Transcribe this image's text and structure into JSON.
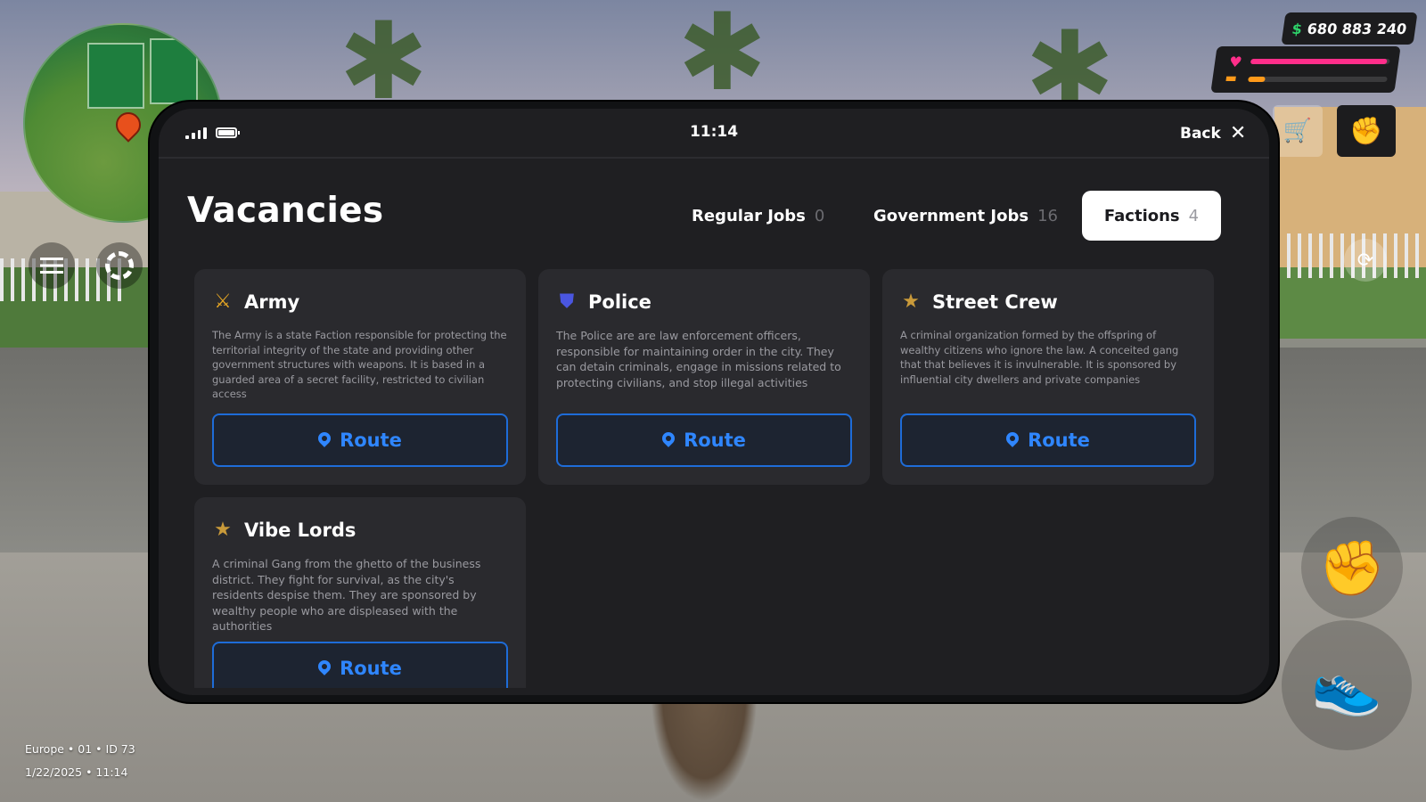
{
  "hud": {
    "money": "680 883 240",
    "money_symbol": "$",
    "health_level": 0.98,
    "food_level": 0.12,
    "server_line": "Europe • 01 • ID 73",
    "datetime_line": "1/22/2025 • 11:14",
    "icons": [
      "minimap",
      "menu-icon",
      "lifebuoy-icon",
      "heart-icon",
      "food-icon",
      "shop-cart-icon",
      "fist-icon",
      "camera-rotate-icon",
      "sprint-shoe-icon"
    ]
  },
  "phone": {
    "time": "11:14",
    "back_label": "Back",
    "title": "Vacancies",
    "tabs": [
      {
        "label": "Regular Jobs",
        "count": "0",
        "active": false
      },
      {
        "label": "Government Jobs",
        "count": "16",
        "active": false
      },
      {
        "label": "Factions",
        "count": "4",
        "active": true
      }
    ],
    "cards": [
      {
        "icon": "crossed-swords-icon",
        "icon_color": "#e6a623",
        "title": "Army",
        "description": "The Army is a state Faction responsible for protecting the territorial integrity of the state and providing other government structures with weapons. It is based in a guarded area of a secret facility, restricted to civilian access",
        "button": "Route"
      },
      {
        "icon": "shield-icon",
        "icon_color": "#4a56e0",
        "title": "Police",
        "description": "The Police are are law enforcement officers, responsible for maintaining order in the city. They can detain criminals, engage in missions related to protecting civilians, and stop illegal activities",
        "button": "Route"
      },
      {
        "icon": "star-icon",
        "icon_color": "#c99a3a",
        "title": "Street Crew",
        "description": "A criminal organization formed by the offspring of wealthy citizens who ignore the law. A conceited gang that that believes it is invulnerable. It is sponsored by influential city dwellers and private companies",
        "button": "Route"
      },
      {
        "icon": "star-icon",
        "icon_color": "#c99a3a",
        "title": "Vibe Lords",
        "description": "A criminal Gang from the ghetto of the business district. They fight for survival, as the city's residents despise them. They are sponsored by wealthy people who are displeased with the authorities",
        "button": "Route"
      }
    ]
  },
  "colors": {
    "accent_blue": "#2f86ff",
    "money_green": "#2ed36a",
    "health_pink": "#ff2e8a",
    "food_orange": "#ff9a1a"
  }
}
